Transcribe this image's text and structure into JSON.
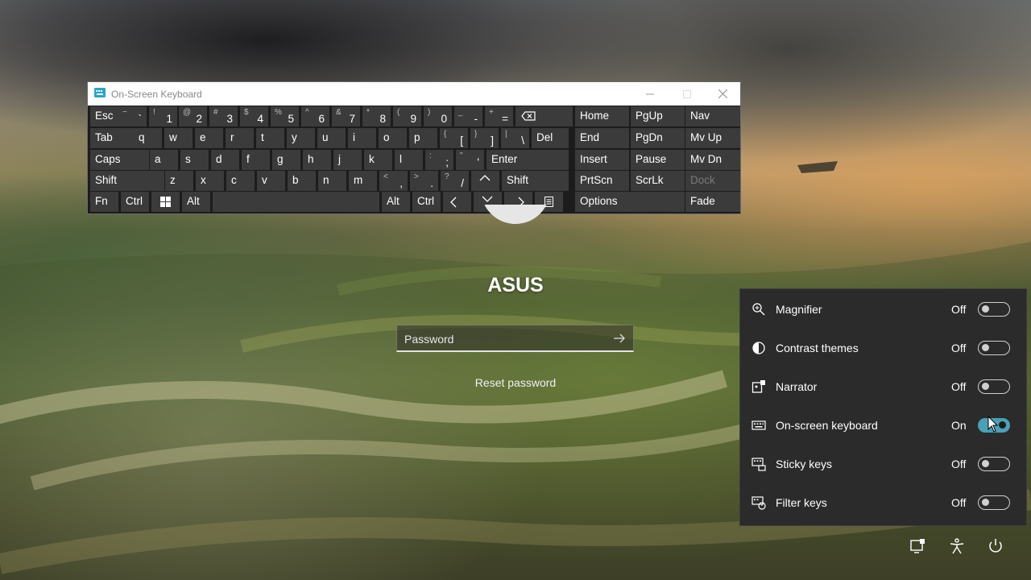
{
  "login": {
    "username": "ASUS",
    "password_placeholder": "Password",
    "reset_password": "Reset password"
  },
  "osk": {
    "title": "On-Screen Keyboard",
    "app_icon": "keyboard-app-icon",
    "keys": [
      {
        "name": "key-esc",
        "main": "Esc"
      },
      {
        "name": "key-backtick",
        "main": "`",
        "shift": "~"
      },
      {
        "name": "key-1",
        "main": "1",
        "shift": "!"
      },
      {
        "name": "key-2",
        "main": "2",
        "shift": "@"
      },
      {
        "name": "key-3",
        "main": "3",
        "shift": "#"
      },
      {
        "name": "key-4",
        "main": "4",
        "shift": "$"
      },
      {
        "name": "key-5",
        "main": "5",
        "shift": "%"
      },
      {
        "name": "key-6",
        "main": "6",
        "shift": "^"
      },
      {
        "name": "key-7",
        "main": "7",
        "shift": "&"
      },
      {
        "name": "key-8",
        "main": "8",
        "shift": "*"
      },
      {
        "name": "key-9",
        "main": "9",
        "shift": "("
      },
      {
        "name": "key-0",
        "main": "0",
        "shift": ")"
      },
      {
        "name": "key-minus",
        "main": "-",
        "shift": "_"
      },
      {
        "name": "key-equals",
        "main": "=",
        "shift": "+"
      },
      {
        "name": "key-backspace",
        "icon": "backspace-icon"
      },
      {
        "name": "key-home",
        "main": "Home"
      },
      {
        "name": "key-pgup",
        "main": "PgUp"
      },
      {
        "name": "key-nav",
        "main": "Nav"
      },
      {
        "name": "key-tab",
        "main": "Tab"
      },
      {
        "name": "key-q",
        "main": "q"
      },
      {
        "name": "key-w",
        "main": "w"
      },
      {
        "name": "key-e",
        "main": "e"
      },
      {
        "name": "key-r",
        "main": "r"
      },
      {
        "name": "key-t",
        "main": "t"
      },
      {
        "name": "key-y",
        "main": "y"
      },
      {
        "name": "key-u",
        "main": "u"
      },
      {
        "name": "key-i",
        "main": "i"
      },
      {
        "name": "key-o",
        "main": "o"
      },
      {
        "name": "key-p",
        "main": "p"
      },
      {
        "name": "key-lbracket",
        "main": "[",
        "shift": "{"
      },
      {
        "name": "key-rbracket",
        "main": "]",
        "shift": "}"
      },
      {
        "name": "key-backslash",
        "main": "\\",
        "shift": "|"
      },
      {
        "name": "key-del",
        "main": "Del"
      },
      {
        "name": "key-end",
        "main": "End"
      },
      {
        "name": "key-pgdn",
        "main": "PgDn"
      },
      {
        "name": "key-mvup",
        "main": "Mv Up"
      },
      {
        "name": "key-caps",
        "main": "Caps"
      },
      {
        "name": "key-a",
        "main": "a"
      },
      {
        "name": "key-s",
        "main": "s"
      },
      {
        "name": "key-d",
        "main": "d"
      },
      {
        "name": "key-f",
        "main": "f"
      },
      {
        "name": "key-g",
        "main": "g"
      },
      {
        "name": "key-h",
        "main": "h"
      },
      {
        "name": "key-j",
        "main": "j"
      },
      {
        "name": "key-k",
        "main": "k"
      },
      {
        "name": "key-l",
        "main": "l"
      },
      {
        "name": "key-semicolon",
        "main": ";",
        "shift": ":"
      },
      {
        "name": "key-quote",
        "main": "'",
        "shift": "\""
      },
      {
        "name": "key-enter",
        "main": "Enter"
      },
      {
        "name": "key-insert",
        "main": "Insert"
      },
      {
        "name": "key-pause",
        "main": "Pause"
      },
      {
        "name": "key-mvdn",
        "main": "Mv Dn"
      },
      {
        "name": "key-shift-left",
        "main": "Shift"
      },
      {
        "name": "key-z",
        "main": "z"
      },
      {
        "name": "key-x",
        "main": "x"
      },
      {
        "name": "key-c",
        "main": "c"
      },
      {
        "name": "key-v",
        "main": "v"
      },
      {
        "name": "key-b",
        "main": "b"
      },
      {
        "name": "key-n",
        "main": "n"
      },
      {
        "name": "key-m",
        "main": "m"
      },
      {
        "name": "key-comma",
        "main": ",",
        "shift": "<"
      },
      {
        "name": "key-period",
        "main": ".",
        "shift": ">"
      },
      {
        "name": "key-slash",
        "main": "/",
        "shift": "?"
      },
      {
        "name": "key-arrow-up",
        "icon": "arrow-up-icon"
      },
      {
        "name": "key-shift-right",
        "main": "Shift"
      },
      {
        "name": "key-prtscn",
        "main": "PrtScn"
      },
      {
        "name": "key-scrlk",
        "main": "ScrLk"
      },
      {
        "name": "key-dock",
        "main": "Dock"
      },
      {
        "name": "key-fn",
        "main": "Fn"
      },
      {
        "name": "key-ctrl-left",
        "main": "Ctrl"
      },
      {
        "name": "key-win",
        "icon": "windows-logo-icon"
      },
      {
        "name": "key-alt-left",
        "main": "Alt"
      },
      {
        "name": "key-space",
        "main": ""
      },
      {
        "name": "key-alt-right",
        "main": "Alt"
      },
      {
        "name": "key-ctrl-right",
        "main": "Ctrl"
      },
      {
        "name": "key-arrow-left",
        "icon": "arrow-left-icon"
      },
      {
        "name": "key-arrow-down",
        "icon": "arrow-down-icon"
      },
      {
        "name": "key-arrow-right",
        "icon": "arrow-right-icon"
      },
      {
        "name": "key-menu",
        "icon": "menu-key-icon"
      },
      {
        "name": "key-options",
        "main": "Options"
      },
      {
        "name": "key-fade",
        "main": "Fade"
      }
    ]
  },
  "accessibility": {
    "items": [
      {
        "name": "magnifier",
        "label": "Magnifier",
        "state": "Off",
        "on": false,
        "icon": "magnifier-icon"
      },
      {
        "name": "contrast-themes",
        "label": "Contrast themes",
        "state": "Off",
        "on": false,
        "icon": "contrast-icon"
      },
      {
        "name": "narrator",
        "label": "Narrator",
        "state": "Off",
        "on": false,
        "icon": "narrator-icon"
      },
      {
        "name": "on-screen-keyboard",
        "label": "On-screen keyboard",
        "state": "On",
        "on": true,
        "icon": "keyboard-icon"
      },
      {
        "name": "sticky-keys",
        "label": "Sticky keys",
        "state": "Off",
        "on": false,
        "icon": "sticky-keys-icon"
      },
      {
        "name": "filter-keys",
        "label": "Filter keys",
        "state": "Off",
        "on": false,
        "icon": "filter-keys-icon"
      }
    ]
  },
  "taskbar": {
    "icons": [
      "network-icon",
      "accessibility-icon",
      "power-icon"
    ]
  },
  "colors": {
    "toggle_on": "#4aa0b5",
    "flyout_bg": "#2b2b2b",
    "key_bg": "#3b3b3b"
  }
}
